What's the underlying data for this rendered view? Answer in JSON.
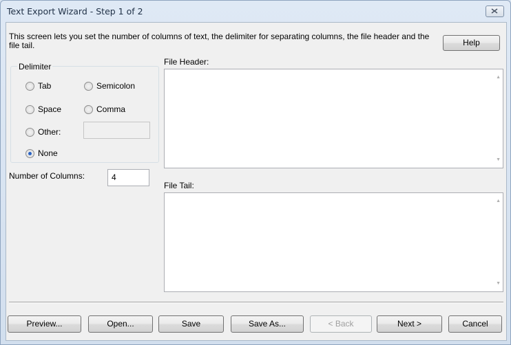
{
  "window": {
    "title": "Text Export Wizard - Step 1 of 2"
  },
  "description": "This screen lets you set the number of columns of text, the delimiter for separating columns, the file header and the file tail.",
  "help_label": "Help",
  "delimiter": {
    "label": "Delimiter",
    "options": {
      "tab": "Tab",
      "semicolon": "Semicolon",
      "space": "Space",
      "comma": "Comma",
      "other": "Other:",
      "none": "None"
    },
    "selected": "None",
    "other_value": ""
  },
  "columns": {
    "label": "Number of Columns:",
    "value": "4"
  },
  "file_header": {
    "label": "File Header:",
    "value": ""
  },
  "file_tail": {
    "label": "File Tail:",
    "value": ""
  },
  "buttons": {
    "preview": "Preview...",
    "open": "Open...",
    "save": "Save",
    "save_as": "Save As...",
    "back": "< Back",
    "next": "Next >",
    "cancel": "Cancel"
  }
}
